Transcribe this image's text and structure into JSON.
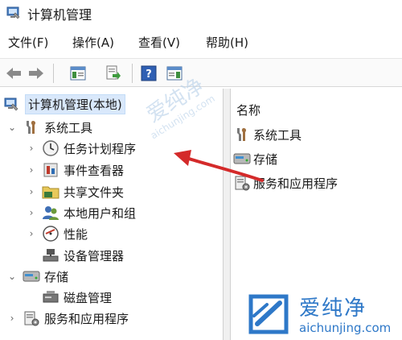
{
  "window": {
    "title": "计算机管理"
  },
  "menu": [
    {
      "label": "文件(F)"
    },
    {
      "label": "操作(A)"
    },
    {
      "label": "查看(V)"
    },
    {
      "label": "帮助(H)"
    }
  ],
  "toolbar": {
    "buttons": [
      "back-arrow-icon",
      "forward-arrow-icon",
      "show-hide-console-tree-icon",
      "export-list-icon",
      "help-icon",
      "properties-panel-icon"
    ]
  },
  "tree": {
    "root": {
      "label": "计算机管理(本地)"
    },
    "items": [
      {
        "label": "系统工具",
        "chevron": "⌄"
      },
      {
        "label": "任务计划程序",
        "chevron": "›"
      },
      {
        "label": "事件查看器",
        "chevron": "›"
      },
      {
        "label": "共享文件夹",
        "chevron": "›"
      },
      {
        "label": "本地用户和组",
        "chevron": "›"
      },
      {
        "label": "性能",
        "chevron": "›"
      },
      {
        "label": "设备管理器",
        "chevron": ""
      },
      {
        "label": "存储",
        "chevron": "⌄"
      },
      {
        "label": "磁盘管理",
        "chevron": ""
      },
      {
        "label": "服务和应用程序",
        "chevron": "›"
      }
    ]
  },
  "list": {
    "header": "名称",
    "items": [
      {
        "label": "系统工具"
      },
      {
        "label": "存储"
      },
      {
        "label": "服务和应用程序"
      }
    ]
  },
  "watermark": {
    "brand": "爱纯净",
    "url": "aichunjing.com",
    "color": "#2e78c8"
  },
  "annotation": {
    "arrow_color": "#d42a2a"
  }
}
